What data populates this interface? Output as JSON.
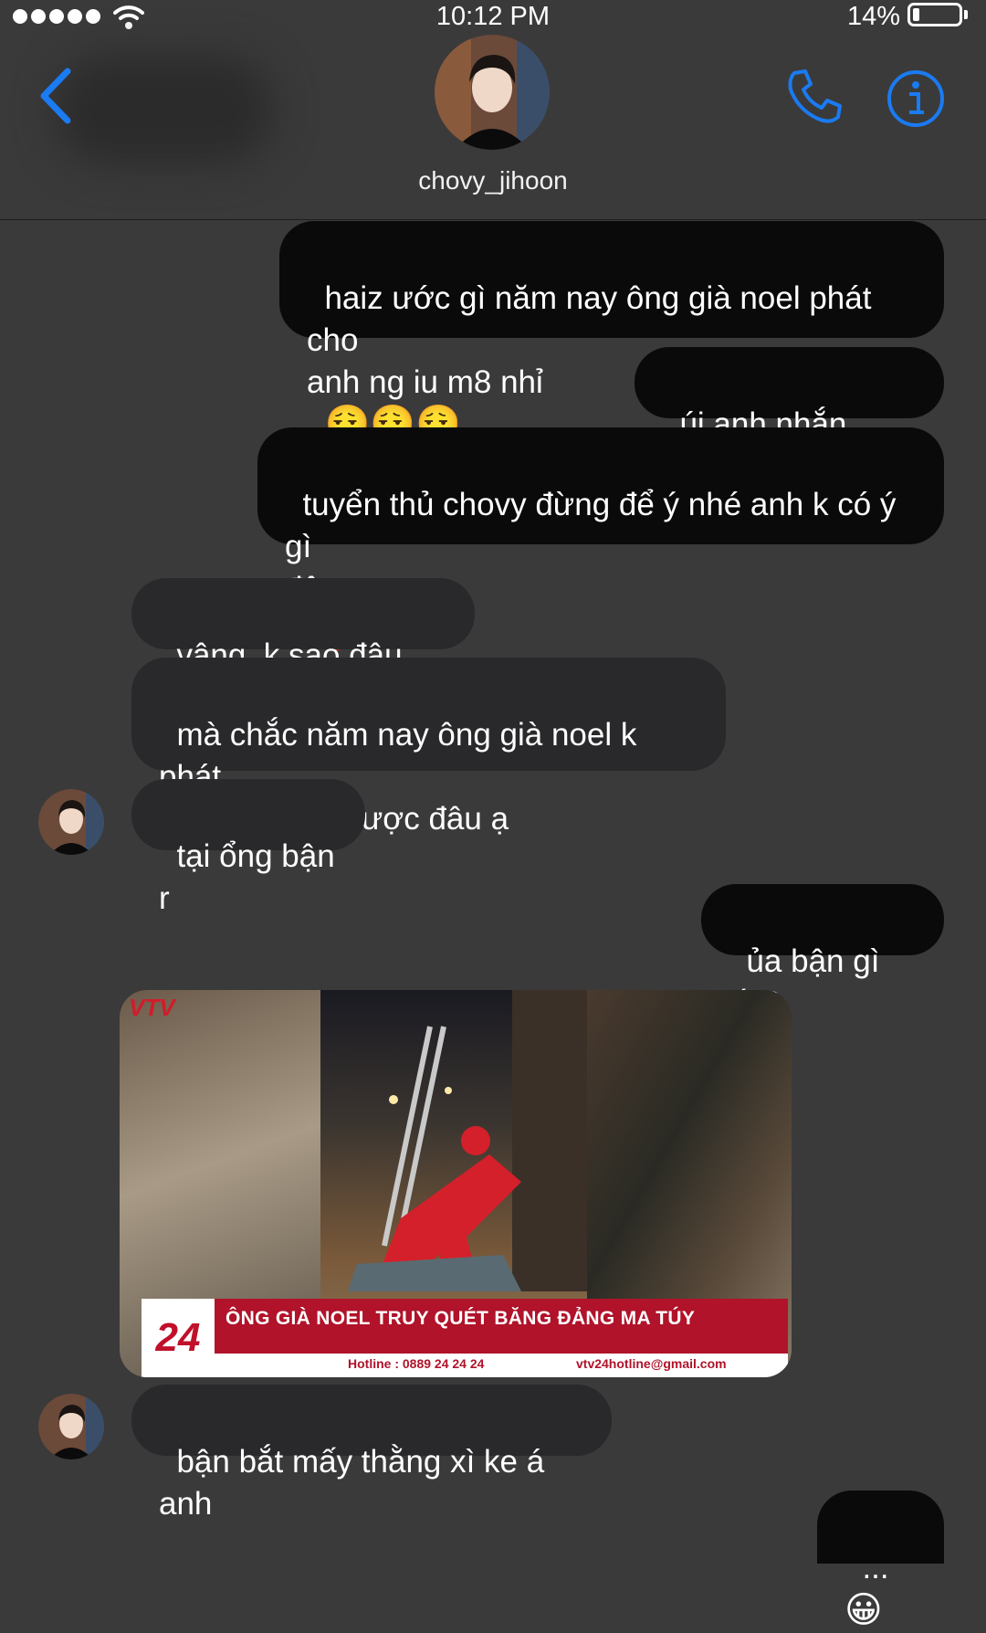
{
  "status": {
    "time": "10:12 PM",
    "battery": "14%",
    "battery_level": 0.14
  },
  "header": {
    "contact_name": "chovy_jihoon"
  },
  "messages": [
    {
      "from": "me",
      "text": "haiz ước gì năm nay ông già noel phát cho\nanh ng iu m8 nhỉ",
      "emoji": "😮‍💨😮‍💨😮‍💨"
    },
    {
      "from": "me",
      "text": "úi anh nhắn nhầm"
    },
    {
      "from": "me",
      "text": "tuyển thủ chovy đừng để ý nhé anh k có ý gì\nđâu",
      "emoji": "🥰"
    },
    {
      "from": "them",
      "text": "vâng, k sao đâu anh"
    },
    {
      "from": "them",
      "text": "mà chắc năm nay ông già noel k phát\nquà cho anh được đâu ạ"
    },
    {
      "from": "them",
      "text": "tại ổng bận r"
    },
    {
      "from": "me",
      "text": "ủa bận gì ấy?"
    },
    {
      "from": "them",
      "text": "bận bắt mấy thằng xì ke á anh"
    },
    {
      "from": "me",
      "text": "...",
      "emoji": "😀"
    }
  ],
  "video": {
    "channel_logo": "VTV",
    "channel_number": "24",
    "headline": "ÔNG GIÀ NOEL TRUY QUÉT BĂNG ĐẢNG MA TÚY",
    "hotline": "Hotline : 0889 24 24 24",
    "email": "vtv24hotline@gmail.com"
  }
}
